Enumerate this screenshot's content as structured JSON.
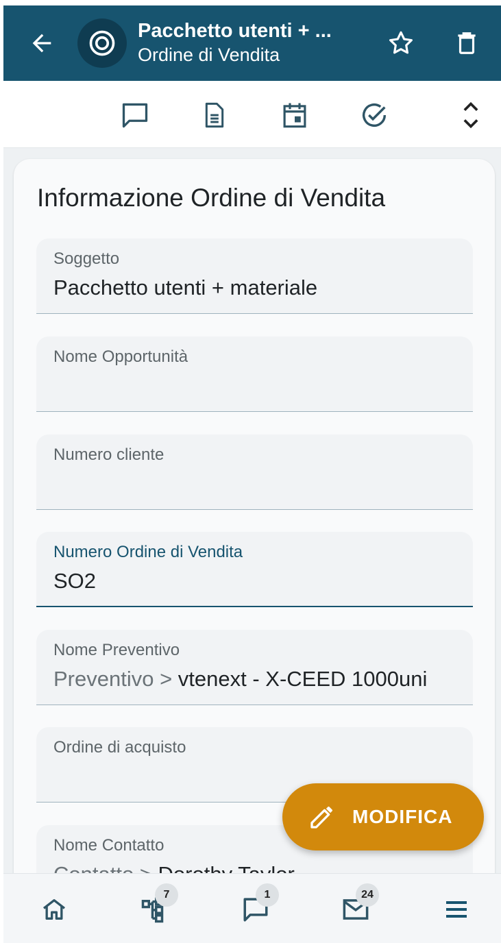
{
  "header": {
    "title": "Pacchetto utenti + ...",
    "subtitle": "Ordine di Vendita",
    "back_icon": "arrow-left-icon",
    "module_icon": "target-icon",
    "favorite_icon": "star-outline-icon",
    "delete_icon": "trash-icon"
  },
  "toolbar": {
    "icons": [
      "comment-icon",
      "document-icon",
      "calendar-icon",
      "check-circle-icon",
      "expand-collapse-icon"
    ]
  },
  "section": {
    "title": "Informazione Ordine di Vendita"
  },
  "fields": [
    {
      "label": "Soggetto",
      "value": "Pacchetto utenti + materiale"
    },
    {
      "label": "Nome Opportunità",
      "value": ""
    },
    {
      "label": "Numero cliente",
      "value": ""
    },
    {
      "label": "Numero Ordine di Vendita",
      "value": "SO2"
    },
    {
      "label": "Nome Preventivo",
      "prefix": "Preventivo > ",
      "value": "vtenext - X-CEED 1000uni"
    },
    {
      "label": "Ordine di acquisto",
      "value": ""
    },
    {
      "label": "Nome Contatto",
      "prefix": "Contatto > ",
      "value": "Dorothy Taylor"
    }
  ],
  "fab": {
    "label": "MODIFICA",
    "icon": "pencil-icon"
  },
  "bottom_nav": {
    "items": [
      {
        "icon": "home-icon",
        "badge": ""
      },
      {
        "icon": "hierarchy-icon",
        "badge": "7"
      },
      {
        "icon": "comment-icon",
        "badge": "1"
      },
      {
        "icon": "mail-icon",
        "badge": "24"
      },
      {
        "icon": "menu-icon",
        "badge": ""
      }
    ]
  },
  "colors": {
    "primary": "#17546f",
    "accent": "#d2890c",
    "icon": "#2f5566"
  }
}
